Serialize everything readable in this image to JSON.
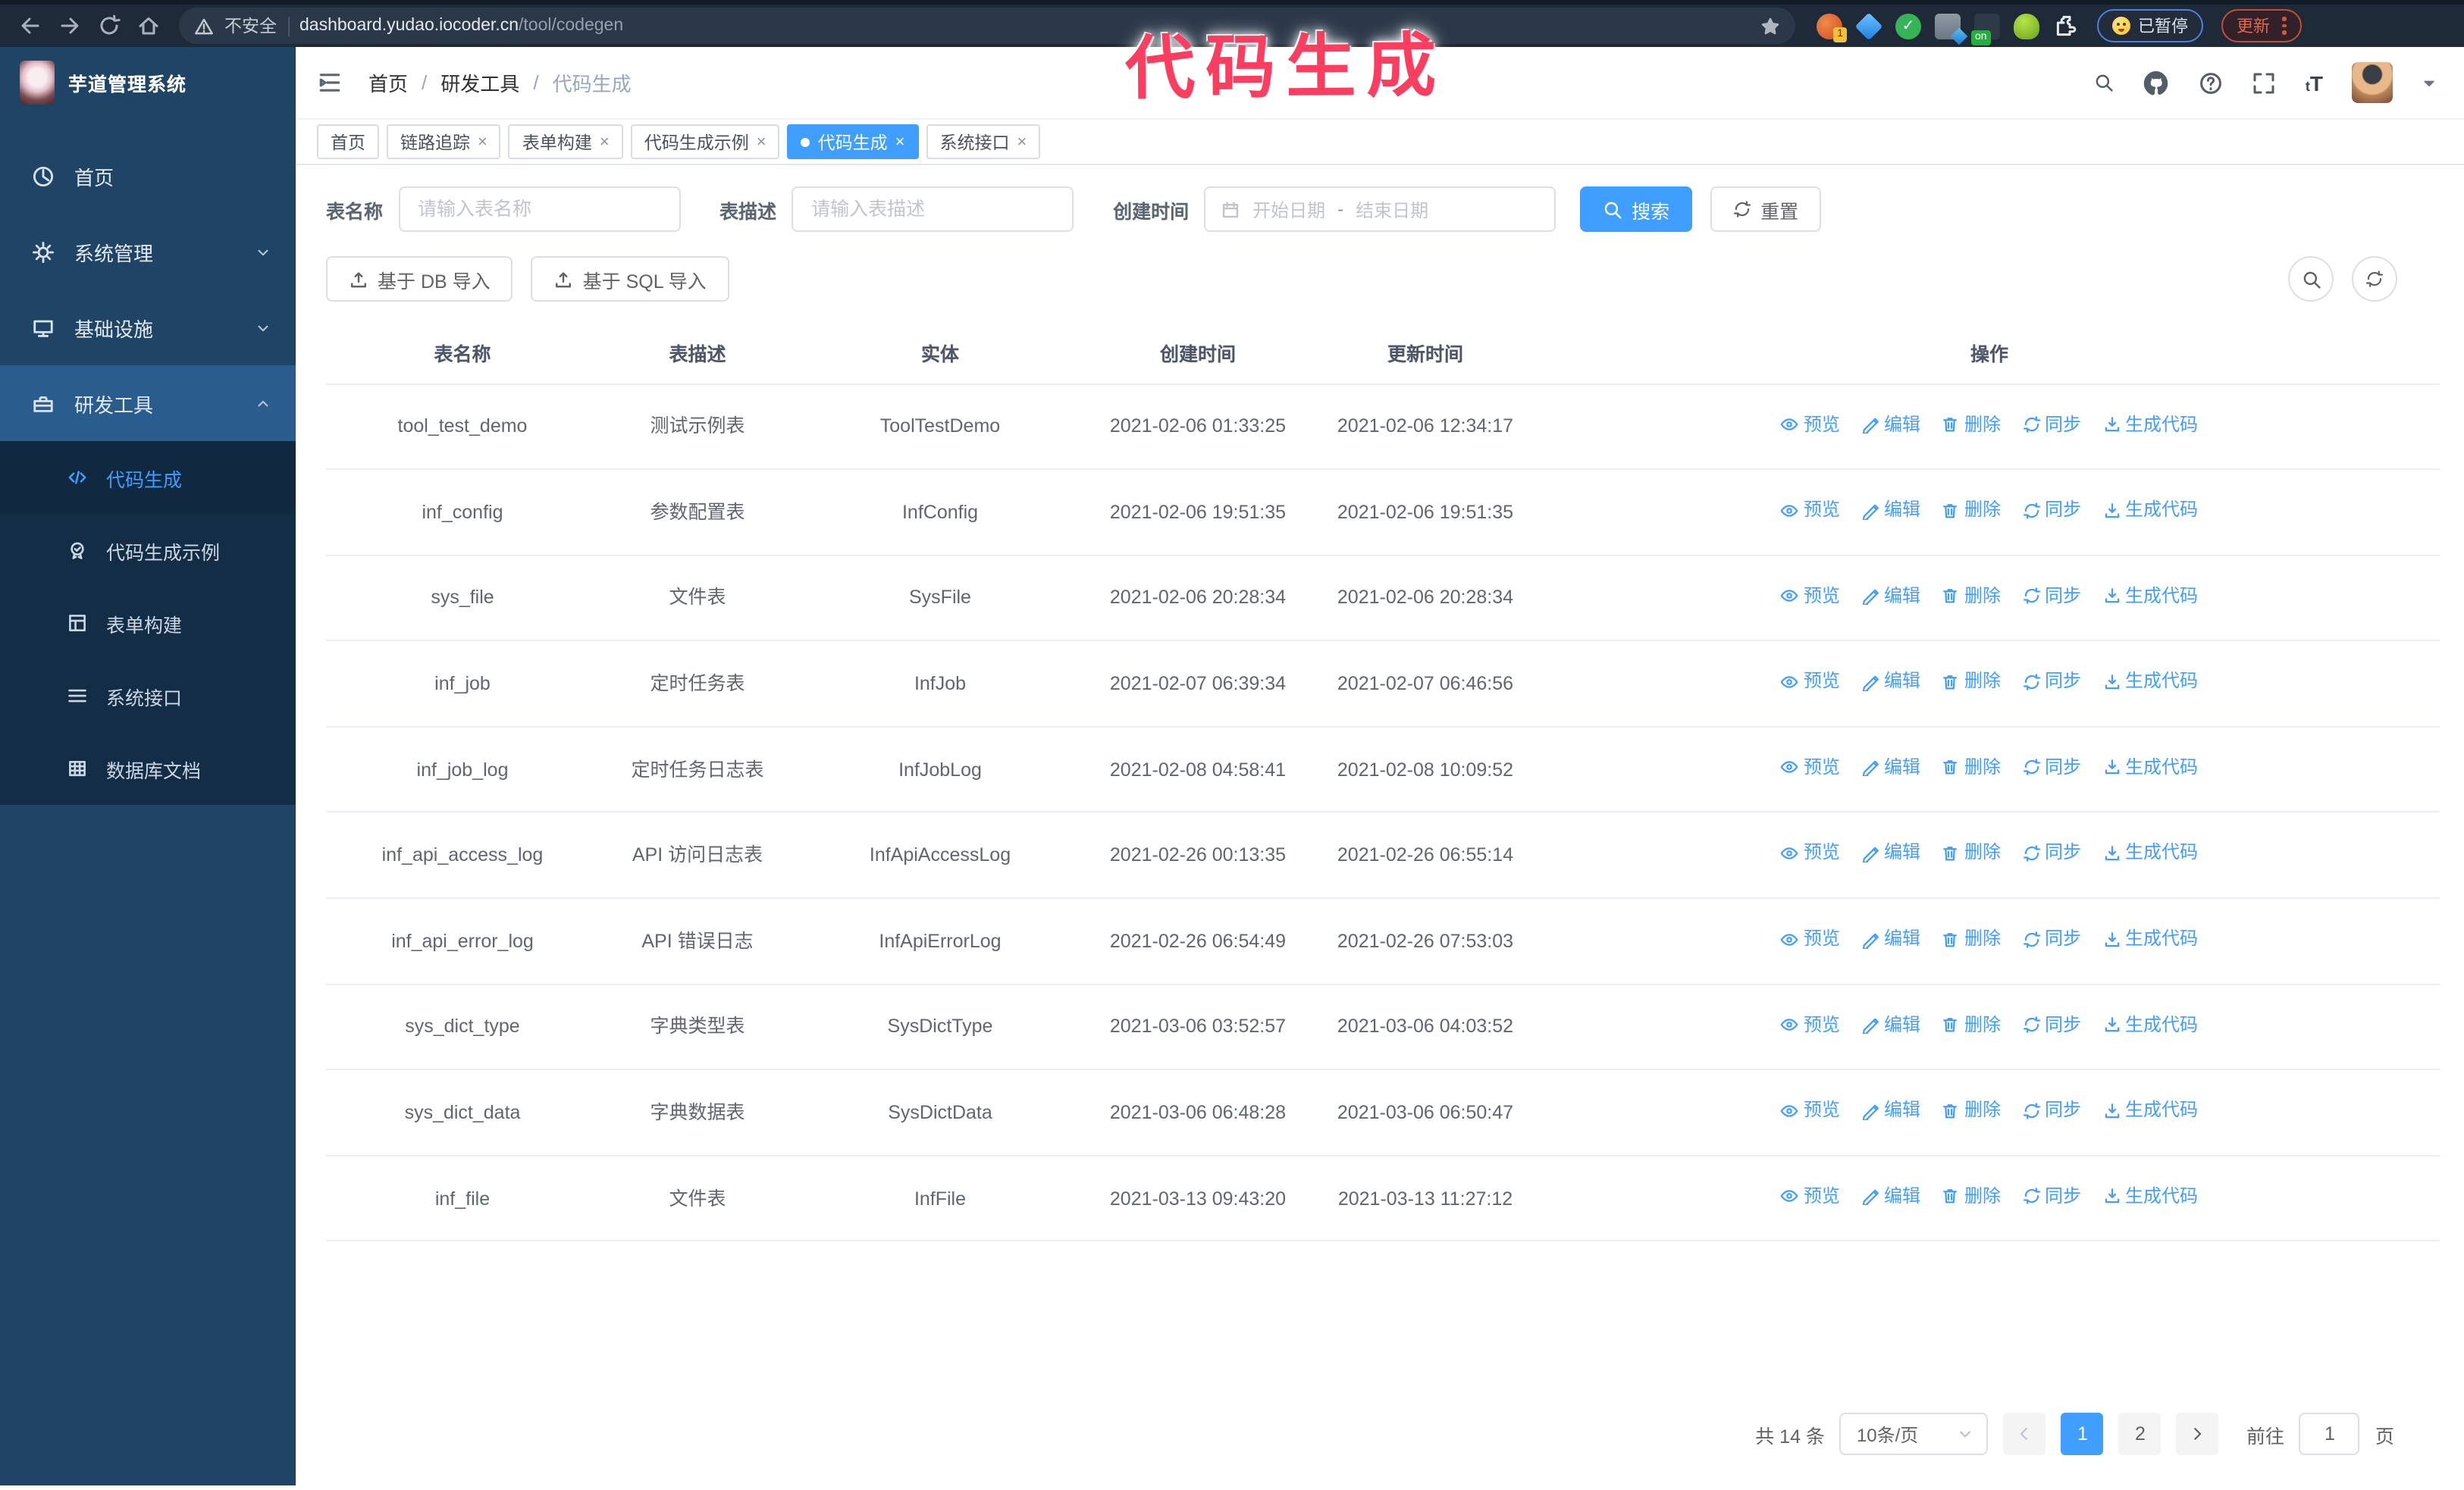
{
  "annotation": {
    "text": "代码生成",
    "color": "#fb3d5f"
  },
  "browser": {
    "security_label": "不安全",
    "url_host": "dashboard.yudao.iocoder.cn",
    "url_path": "/tool/codegen",
    "extensions": {
      "colorzilla_badge": "1",
      "on_badge": "on"
    },
    "paused_label": "已暂停",
    "update_label": "更新"
  },
  "sidebar": {
    "logo_title": "芋道管理系统",
    "items": [
      {
        "label": "首页",
        "icon": "dashboard-icon",
        "chevron": ""
      },
      {
        "label": "系统管理",
        "icon": "gear-icon",
        "chevron": "down"
      },
      {
        "label": "基础设施",
        "icon": "monitor-icon",
        "chevron": "down"
      },
      {
        "label": "研发工具",
        "icon": "toolbox-icon",
        "chevron": "up",
        "highlight": true
      }
    ],
    "subitems": [
      {
        "label": "代码生成",
        "icon": "code-icon",
        "active": true
      },
      {
        "label": "代码生成示例",
        "icon": "seal-icon"
      },
      {
        "label": "表单构建",
        "icon": "form-icon"
      },
      {
        "label": "系统接口",
        "icon": "api-icon"
      },
      {
        "label": "数据库文档",
        "icon": "database-icon"
      }
    ]
  },
  "header": {
    "breadcrumb": [
      "首页",
      "研发工具",
      "代码生成"
    ],
    "separator": "/",
    "font_size_glyph": "tT"
  },
  "tabs": [
    {
      "label": "首页",
      "closable": false,
      "active": false
    },
    {
      "label": "链路追踪",
      "closable": true,
      "active": false
    },
    {
      "label": "表单构建",
      "closable": true,
      "active": false
    },
    {
      "label": "代码生成示例",
      "closable": true,
      "active": false
    },
    {
      "label": "代码生成",
      "closable": true,
      "active": true
    },
    {
      "label": "系统接口",
      "closable": true,
      "active": false
    }
  ],
  "filters": {
    "name_label": "表名称",
    "name_placeholder": "请输入表名称",
    "desc_label": "表描述",
    "desc_placeholder": "请输入表描述",
    "time_label": "创建时间",
    "date_start_placeholder": "开始日期",
    "date_separator": "-",
    "date_end_placeholder": "结束日期",
    "search_label": "搜索",
    "reset_label": "重置"
  },
  "toolbar": {
    "db_import_label": "基于 DB 导入",
    "sql_import_label": "基于 SQL 导入"
  },
  "table": {
    "columns": [
      "表名称",
      "表描述",
      "实体",
      "创建时间",
      "更新时间",
      "操作"
    ],
    "actions": [
      "预览",
      "编辑",
      "删除",
      "同步",
      "生成代码"
    ],
    "rows": [
      {
        "name": "tool_test_demo",
        "desc": "测试示例表",
        "entity": "ToolTestDemo",
        "created": "2021-02-06 01:33:25",
        "updated": "2021-02-06 12:34:17"
      },
      {
        "name": "inf_config",
        "desc": "参数配置表",
        "entity": "InfConfig",
        "created": "2021-02-06 19:51:35",
        "updated": "2021-02-06 19:51:35"
      },
      {
        "name": "sys_file",
        "desc": "文件表",
        "entity": "SysFile",
        "created": "2021-02-06 20:28:34",
        "updated": "2021-02-06 20:28:34"
      },
      {
        "name": "inf_job",
        "desc": "定时任务表",
        "entity": "InfJob",
        "created": "2021-02-07 06:39:34",
        "updated": "2021-02-07 06:46:56"
      },
      {
        "name": "inf_job_log",
        "desc": "定时任务日志表",
        "entity": "InfJobLog",
        "created": "2021-02-08 04:58:41",
        "updated": "2021-02-08 10:09:52"
      },
      {
        "name": "inf_api_access_log",
        "desc": "API 访问日志表",
        "entity": "InfApiAccessLog",
        "created": "2021-02-26 00:13:35",
        "updated": "2021-02-26 06:55:14"
      },
      {
        "name": "inf_api_error_log",
        "desc": "API 错误日志",
        "entity": "InfApiErrorLog",
        "created": "2021-02-26 06:54:49",
        "updated": "2021-02-26 07:53:03"
      },
      {
        "name": "sys_dict_type",
        "desc": "字典类型表",
        "entity": "SysDictType",
        "created": "2021-03-06 03:52:57",
        "updated": "2021-03-06 04:03:52"
      },
      {
        "name": "sys_dict_data",
        "desc": "字典数据表",
        "entity": "SysDictData",
        "created": "2021-03-06 06:48:28",
        "updated": "2021-03-06 06:50:47"
      },
      {
        "name": "inf_file",
        "desc": "文件表",
        "entity": "InfFile",
        "created": "2021-03-13 09:43:20",
        "updated": "2021-03-13 11:27:12"
      }
    ]
  },
  "pagination": {
    "total_label": "共 14 条",
    "page_size_value": "10条/页",
    "pages": [
      "1",
      "2"
    ],
    "active_page": "1",
    "goto_label": "前往",
    "goto_value": "1",
    "page_unit": "页"
  },
  "colors": {
    "primary": "#409eff",
    "sidebar": "#1f4466",
    "submenu": "#142d47",
    "annotation": "#fb3d5f"
  }
}
